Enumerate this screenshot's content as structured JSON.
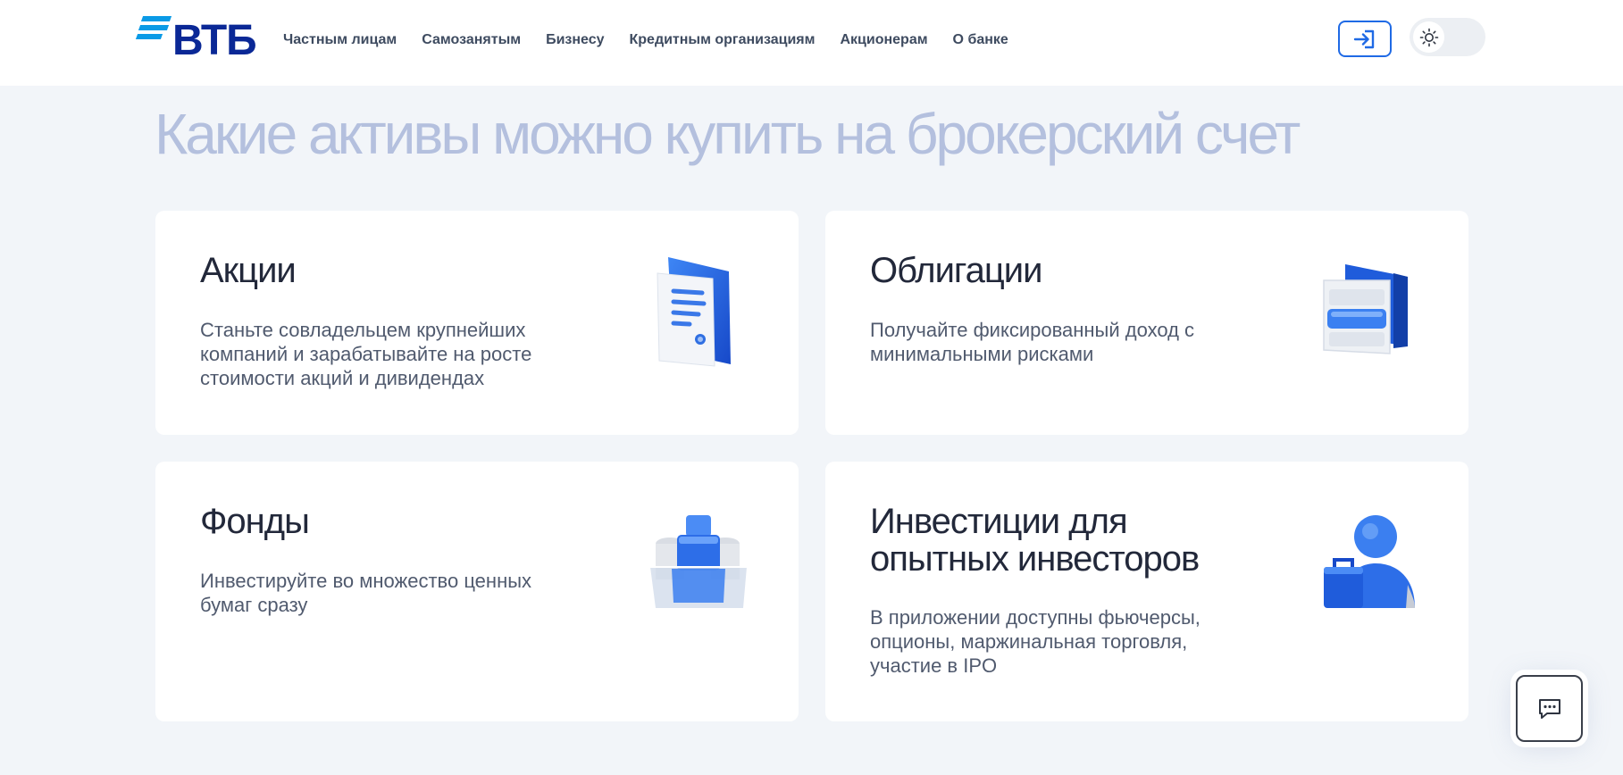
{
  "header": {
    "logo_text": "ВТБ",
    "nav": [
      "Частным лицам",
      "Самозанятым",
      "Бизнесу",
      "Кредитным организациям",
      "Акционерам",
      "О банке"
    ],
    "login_icon": "login-arrow-icon",
    "theme_icon": "sun-icon"
  },
  "page_title": "Какие активы можно купить на брокерский счет",
  "cards": [
    {
      "title": "Акции",
      "description": "Станьте совладельцем крупнейших компаний и зарабатывайте на росте стоимости акций и дивидендах",
      "icon": "document-folder-icon"
    },
    {
      "title": "Облигации",
      "description": "Получайте фиксированный доход с минимальными рисками",
      "icon": "bond-box-icon"
    },
    {
      "title": "Фонды",
      "description": "Инвестируйте во множество ценных бумаг сразу",
      "icon": "fund-blocks-icon"
    },
    {
      "title": "Инвестиции для опытных инвесторов",
      "description": "В приложении доступны фьючерсы, опционы, маржинальная торговля, участие в IPO",
      "icon": "investor-person-icon"
    }
  ],
  "chat_icon": "chat-bubble-icon",
  "colors": {
    "brand_blue": "#0a2896",
    "accent_blue": "#1f6ae5",
    "title_light": "#b4c0de",
    "background": "#f2f5f9"
  }
}
